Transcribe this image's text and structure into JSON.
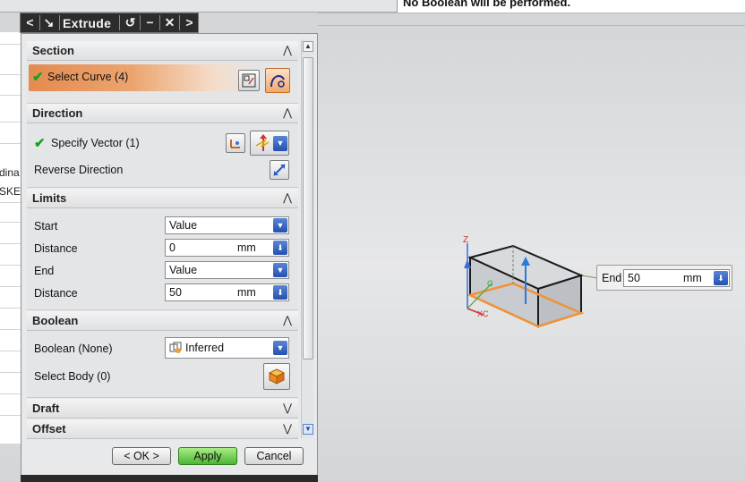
{
  "status_message": "No Boolean will be performed.",
  "navigator": {
    "text_rows": [
      "dina",
      "SKET"
    ]
  },
  "titlebar": {
    "title": "Extrude",
    "back_glyph": "<",
    "forward_glyph": ">",
    "close_glyph": "✕",
    "minimize_glyph": "−"
  },
  "sections": {
    "section": {
      "title": "Section",
      "select_curve_label": "Select Curve (4)",
      "chevron": "up"
    },
    "direction": {
      "title": "Direction",
      "specify_vector_label": "Specify Vector (1)",
      "reverse_label": "Reverse Direction"
    },
    "limits": {
      "title": "Limits",
      "start_label": "Start",
      "start_value": "Value",
      "start_distance_label": "Distance",
      "start_distance_value": "0",
      "start_distance_unit": "mm",
      "end_label": "End",
      "end_value": "Value",
      "end_distance_label": "Distance",
      "end_distance_value": "50",
      "end_distance_unit": "mm"
    },
    "boolean": {
      "title": "Boolean",
      "boolean_label": "Boolean (None)",
      "boolean_value": "Inferred",
      "select_body_label": "Select Body (0)"
    },
    "draft": {
      "title": "Draft"
    },
    "offset": {
      "title": "Offset"
    }
  },
  "buttons": {
    "ok": "< OK >",
    "apply": "Apply",
    "cancel": "Cancel"
  },
  "end_handle": {
    "label": "End",
    "value": "50",
    "unit": "mm"
  },
  "axes": {
    "z": "Z",
    "xc": "XC",
    "c": "C"
  },
  "colors": {
    "accent_orange": "#e8924f",
    "check_green": "#18a021",
    "apply_green": "#4cb632",
    "dropdown_blue": "#2f5cc0"
  }
}
